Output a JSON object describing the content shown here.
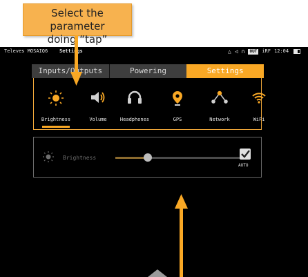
{
  "callout": {
    "text_line1": "Select the parameter",
    "text_line2": "doing “tap”"
  },
  "statusbar": {
    "left_text": "Televes MOSAIQ6",
    "title": "Settings",
    "out_badge": "OUT",
    "irf": "iRF",
    "time": "12:04"
  },
  "tabs": [
    {
      "label": "Inputs/Outputs",
      "active": false
    },
    {
      "label": "Powering",
      "active": false
    },
    {
      "label": "Settings",
      "active": true
    }
  ],
  "settings_items": [
    {
      "label": "Brightness",
      "icon": "sun-icon",
      "selected": true
    },
    {
      "label": "Volume",
      "icon": "speaker-icon",
      "selected": false
    },
    {
      "label": "Headphones",
      "icon": "headphones-icon",
      "selected": false
    },
    {
      "label": "GPS",
      "icon": "location-pin-icon",
      "selected": false
    },
    {
      "label": "Network",
      "icon": "network-icon",
      "selected": false
    },
    {
      "label": "WiFi",
      "icon": "wifi-icon",
      "selected": false
    }
  ],
  "brightness_control": {
    "label": "Brightness",
    "level_fraction": 0.25,
    "auto_label": "AUTO",
    "auto_checked": true
  },
  "colors": {
    "accent": "#f9a825",
    "callout_bg": "#f7b24f",
    "screen_bg": "#000000"
  }
}
